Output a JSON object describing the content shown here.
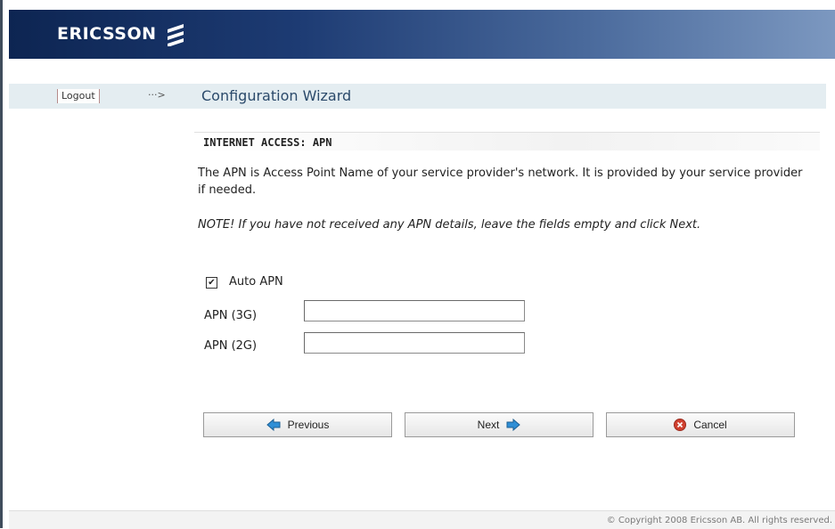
{
  "header": {
    "brand": "ERICSSON",
    "logo_icon": "ericsson-logo-icon"
  },
  "nav": {
    "logout_label": "Logout",
    "arrow": "···>",
    "title": "Configuration Wizard"
  },
  "section": {
    "title": "INTERNET ACCESS: APN"
  },
  "description": "The APN is Access Point Name of your service provider's network. It is provided by your service provider if needed.",
  "note": "NOTE! If you have not received any APN details, leave the fields empty and click Next.",
  "form": {
    "auto_apn": {
      "label": "Auto APN",
      "checked": true,
      "mark": "✔"
    },
    "apn_3g": {
      "label": "APN (3G)",
      "value": ""
    },
    "apn_2g": {
      "label": "APN (2G)",
      "value": ""
    }
  },
  "buttons": {
    "previous": {
      "label": "Previous",
      "icon": "arrow-left-icon"
    },
    "next": {
      "label": "Next",
      "icon": "arrow-right-icon"
    },
    "cancel": {
      "label": "Cancel",
      "icon": "cancel-icon"
    }
  },
  "footer": {
    "copyright": "© Copyright 2008 Ericsson AB. All rights reserved."
  },
  "colors": {
    "header_dark": "#0d2552",
    "header_light": "#7c98c0",
    "nav_bg": "#e4edf1",
    "title_color": "#2b4a6b",
    "cancel_red": "#c0392b"
  }
}
